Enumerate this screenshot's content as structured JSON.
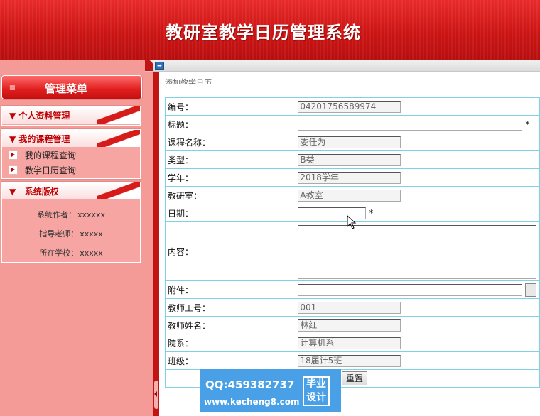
{
  "header": {
    "title": "教研室教学日历管理系统"
  },
  "sidebar": {
    "menu_title": "管理菜单",
    "sections": [
      {
        "title": "个人资料管理",
        "items": []
      },
      {
        "title": "我的课程管理",
        "items": [
          "我的课程查询",
          "教学日历查询"
        ]
      },
      {
        "title": "系统版权",
        "copyright": [
          {
            "label": "系统作者：",
            "value": "xxxxxx"
          },
          {
            "label": "指导老师：",
            "value": "xxxxx"
          },
          {
            "label": "所在学校：",
            "value": "xxxxx"
          }
        ]
      }
    ]
  },
  "form": {
    "crumb": "添加教学日历",
    "rows": [
      {
        "label": "编号：",
        "value": "04201756589974",
        "readonly": true
      },
      {
        "label": "标题：",
        "value": "",
        "required": "*"
      },
      {
        "label": "课程名称：",
        "value": "委任为",
        "readonly": true
      },
      {
        "label": "类型：",
        "value": "B类",
        "readonly": true
      },
      {
        "label": "学年：",
        "value": "2018学年",
        "readonly": true
      },
      {
        "label": "教研室：",
        "value": "A教室",
        "readonly": true
      },
      {
        "label": "日期：",
        "value": "",
        "required": "*"
      },
      {
        "label": "内容：",
        "value": ""
      },
      {
        "label": "附件：",
        "value": ""
      },
      {
        "label": "教师工号：",
        "value": "001",
        "readonly": true
      },
      {
        "label": "教师姓名：",
        "value": "林红",
        "readonly": true
      },
      {
        "label": "院系：",
        "value": "计算机系",
        "readonly": true
      },
      {
        "label": "班级：",
        "value": "18届计5班",
        "readonly": true
      }
    ],
    "reset_label": "重置"
  },
  "watermark": {
    "qq": "QQ:459382737",
    "site": "www.kecheng8.com",
    "badge_line1": "毕业",
    "badge_line2": "设计"
  },
  "colors": {
    "header_red": "#cc1414",
    "sidebar_pink": "#f49a97",
    "table_border": "#7fd2e6",
    "watermark_blue": "#4aa0e6"
  }
}
